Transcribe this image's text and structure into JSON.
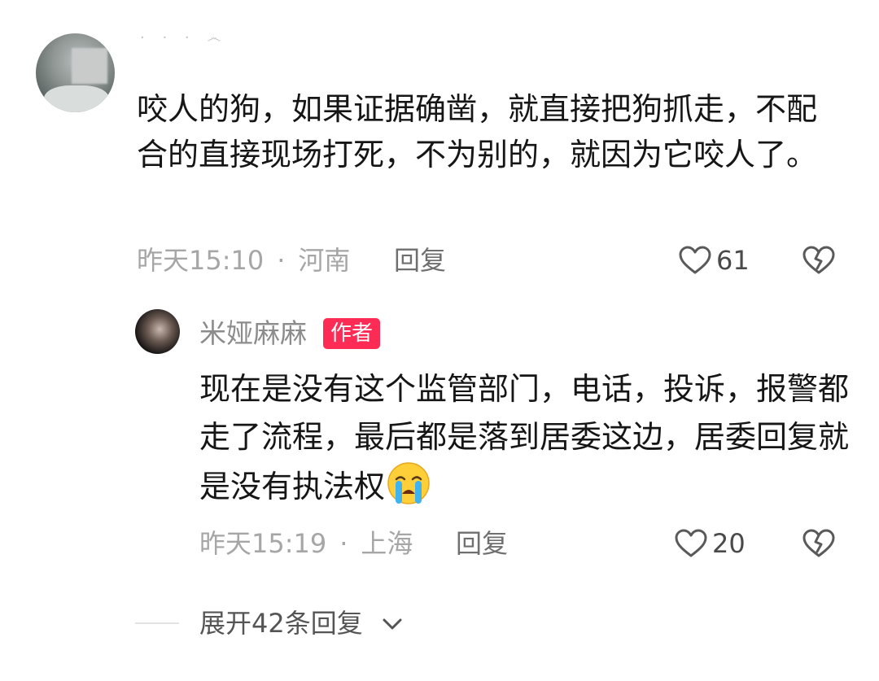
{
  "comment": {
    "masked_name": "· · · ෴",
    "text": "咬人的狗，如果证据确凿，就直接把狗抓走，不配合的直接现场打死，不为别的，就因为它咬人了。",
    "time": "昨天15:10",
    "separator": "·",
    "location": "河南",
    "reply_label": "回复",
    "likes": "61",
    "icons": {
      "like": "heart-outline-icon",
      "dislike": "broken-heart-icon"
    }
  },
  "author_reply": {
    "name": "米娅麻麻",
    "badge": "作者",
    "text": "现在是没有这个监管部门，电话，投诉，报警都走了流程，最后都是落到居委这边，居委回复就是没有执法权",
    "emoji": "loudly-crying-face-emoji",
    "time": "昨天15:19",
    "separator": "·",
    "location": "上海",
    "reply_label": "回复",
    "likes": "20"
  },
  "expand": {
    "label": "展开42条回复",
    "icon": "chevron-down-icon"
  },
  "colors": {
    "badge": "#fe2c55",
    "meta": "#a6a6a6",
    "text": "#161616"
  }
}
